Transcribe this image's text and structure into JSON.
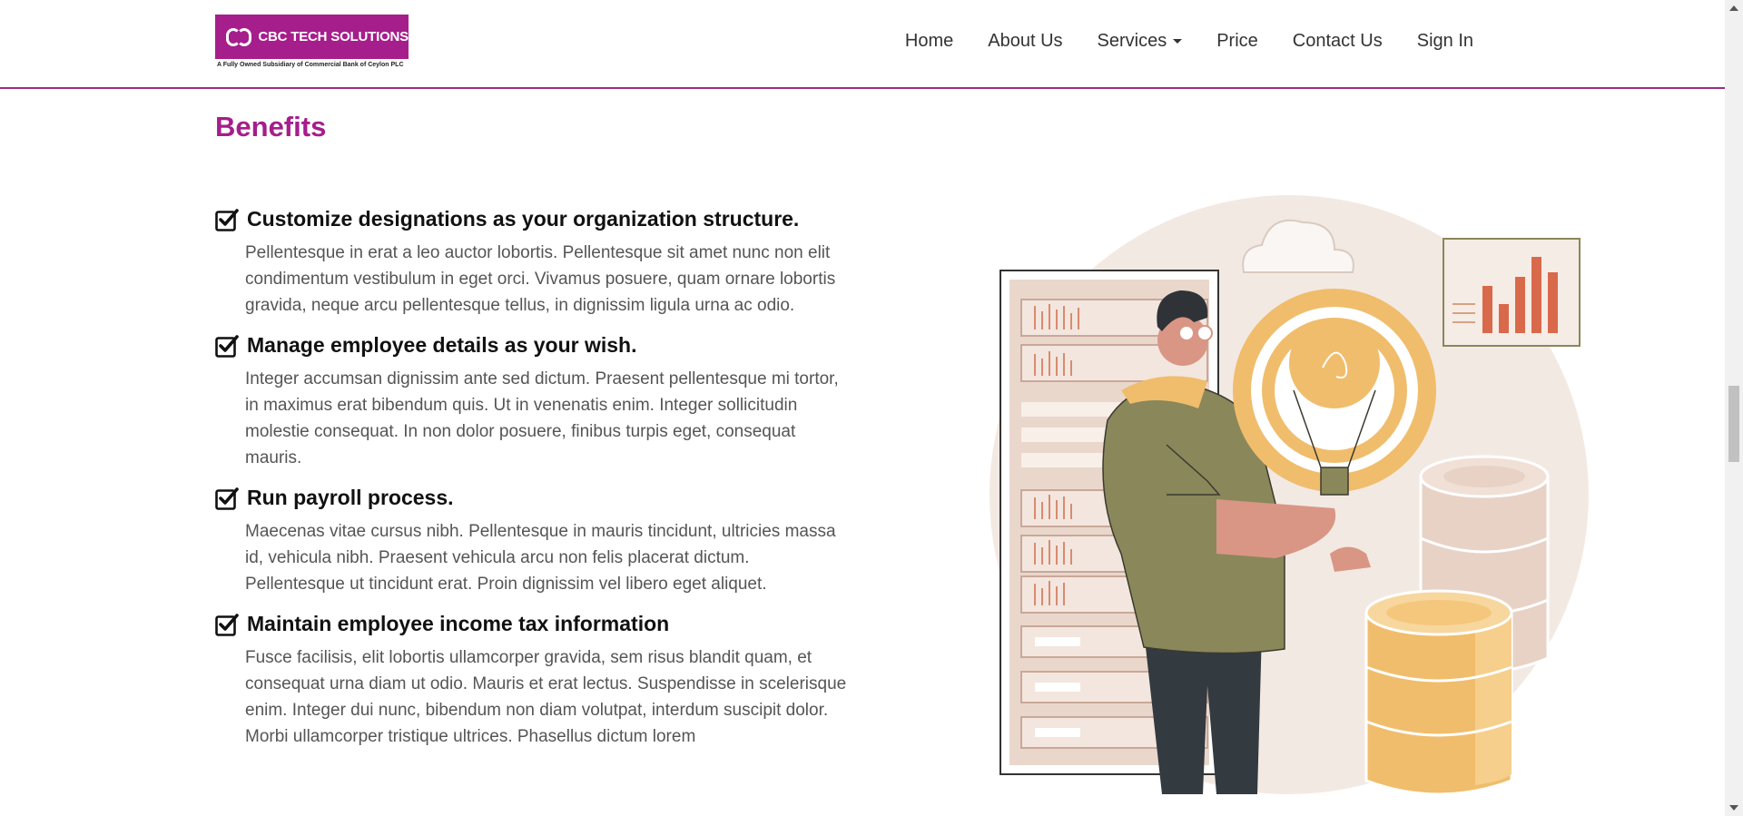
{
  "brand": {
    "name": "CBC TECH SOLUTIONS",
    "tagline": "A Fully Owned Subsidiary of Commercial Bank of Ceylon PLC",
    "color": "#a51e8b"
  },
  "nav": {
    "items": [
      {
        "label": "Home"
      },
      {
        "label": "About Us"
      },
      {
        "label": "Services"
      },
      {
        "label": "Price"
      },
      {
        "label": "Contact Us"
      },
      {
        "label": "Sign In"
      }
    ]
  },
  "section": {
    "title": "Benefits",
    "benefits": [
      {
        "title": "Customize designations as your organization structure.",
        "text": "Pellentesque in erat a leo auctor lobortis. Pellentesque sit amet nunc non elit condimentum vestibulum in eget orci. Vivamus posuere, quam ornare lobortis gravida, neque arcu pellentesque tellus, in dignissim ligula urna ac odio."
      },
      {
        "title": "Manage employee details as your wish.",
        "text": "Integer accumsan dignissim ante sed dictum. Praesent pellentesque mi tortor, in maximus erat bibendum quis. Ut in venenatis enim. Integer sollicitudin molestie consequat. In non dolor posuere, finibus turpis eget, consequat mauris."
      },
      {
        "title": "Run payroll process.",
        "text": "Maecenas vitae cursus nibh. Pellentesque in mauris tincidunt, ultricies massa id, vehicula nibh. Praesent vehicula arcu non felis placerat dictum. Pellentesque ut tincidunt erat. Proin dignissim vel libero eget aliquet."
      },
      {
        "title": "Maintain employee income tax information",
        "text": "Fusce facilisis, elit lobortis ullamcorper gravida, sem risus blandit quam, et consequat urna diam ut odio. Mauris et erat lectus. Suspendisse in scelerisque enim. Integer dui nunc, bibendum non diam volutpat, interdum suscipit dolor. Morbi ullamcorper tristique ultrices. Phasellus dictum lorem"
      }
    ]
  },
  "icons": {
    "check": "checkbox-checked-icon",
    "caret": "caret-down-icon"
  }
}
